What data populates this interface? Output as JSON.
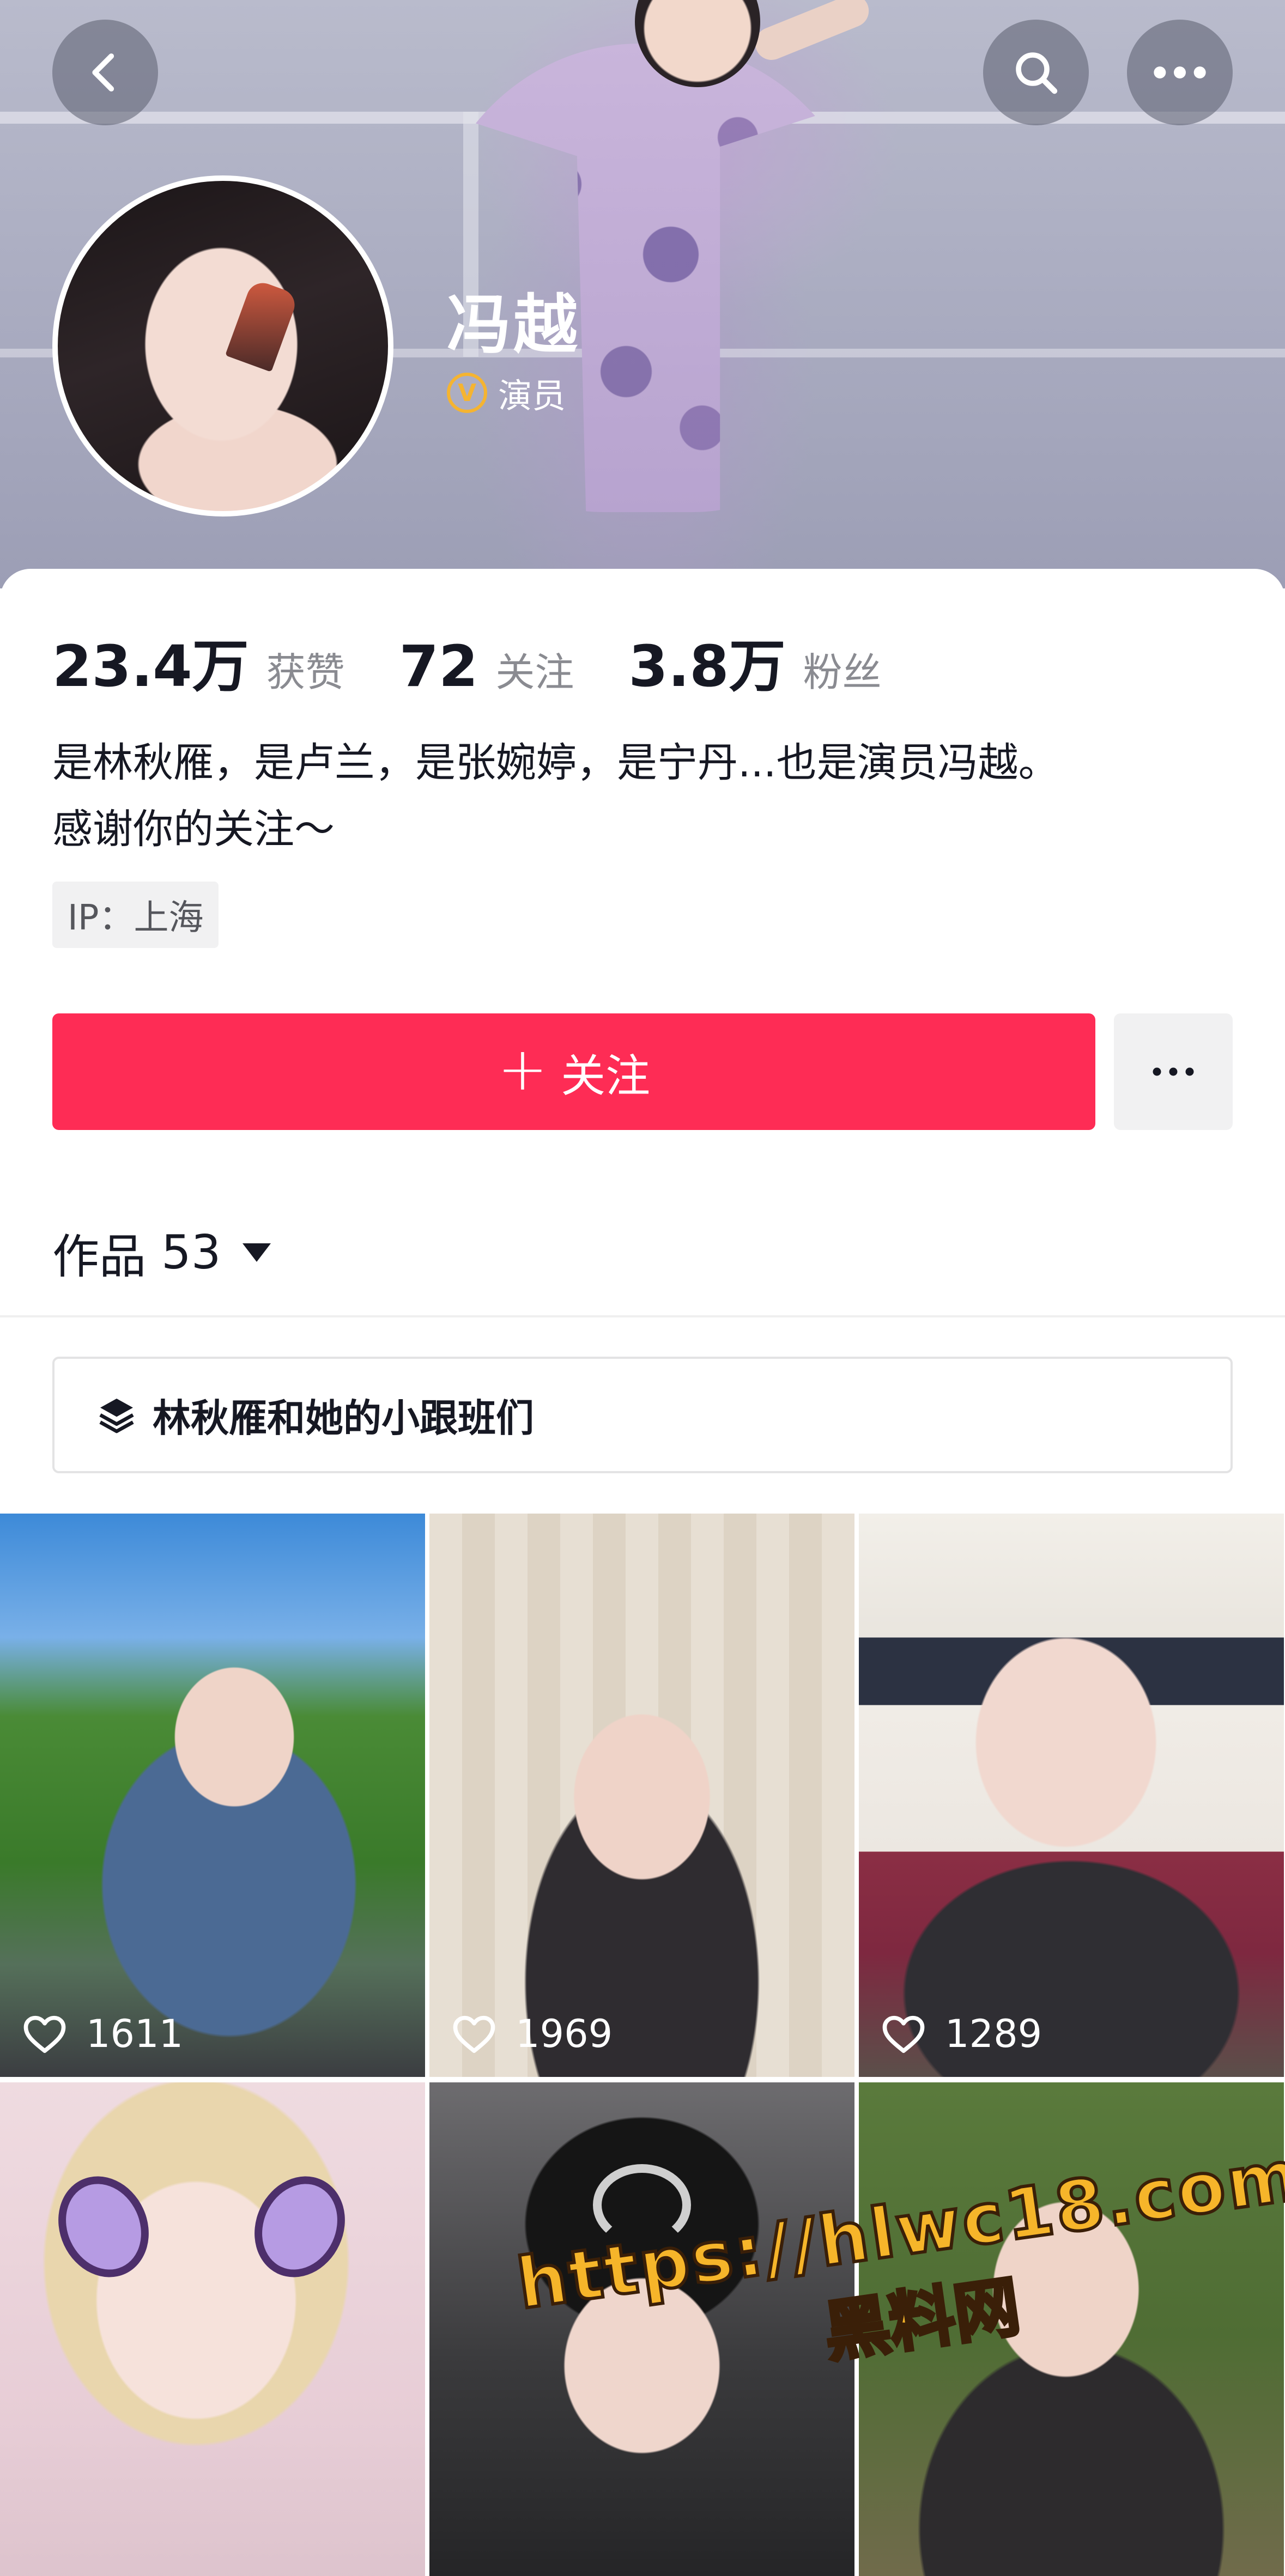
{
  "header": {
    "name": "冯越",
    "verified_badge_symbol": "V",
    "verified_title": "演员"
  },
  "stats": [
    {
      "value": "23.4万",
      "label": "获赞"
    },
    {
      "value": "72",
      "label": "关注"
    },
    {
      "value": "3.8万",
      "label": "粉丝"
    }
  ],
  "bio": {
    "line1": "是林秋雁，是卢兰，是张婉婷，是宁丹...也是演员冯越。",
    "line2": "感谢你的关注～"
  },
  "ip_tag": "IP：上海",
  "actions": {
    "follow_plus": "+",
    "follow_label": "关注"
  },
  "works": {
    "label": "作品",
    "count": "53"
  },
  "playlist": {
    "title": "林秋雁和她的小跟班们"
  },
  "videos": [
    {
      "likes": "1611"
    },
    {
      "likes": "1969"
    },
    {
      "likes": "1289"
    },
    {
      "likes": ""
    },
    {
      "likes": ""
    },
    {
      "likes": ""
    }
  ],
  "watermark": {
    "url": "https://hlwc18.com",
    "text": "黑料网"
  },
  "colors": {
    "accent": "#fe2c55",
    "verified": "#f5b431",
    "watermark": "#f6b52a"
  },
  "icons": {
    "back": "chevron-left-icon",
    "search": "search-icon",
    "more": "ellipsis-icon",
    "verified": "verified-v-icon",
    "works_dropdown": "caret-down-icon",
    "playlist": "layers-icon",
    "likes": "heart-icon"
  }
}
